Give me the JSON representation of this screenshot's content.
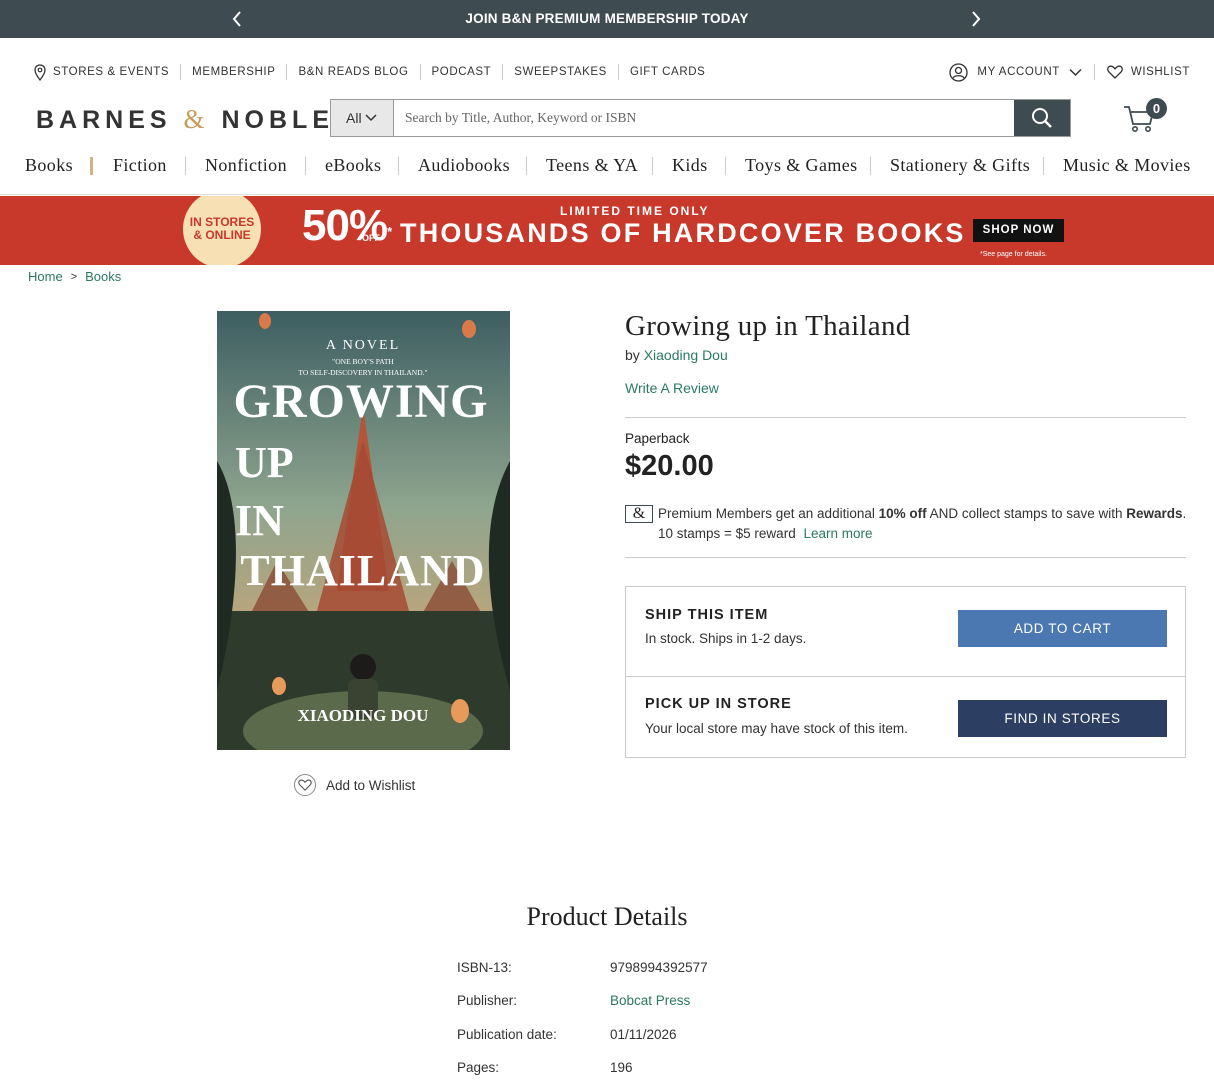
{
  "promo": {
    "message": "JOIN B&N PREMIUM MEMBERSHIP TODAY"
  },
  "utility_nav": {
    "links": [
      "STORES & EVENTS",
      "MEMBERSHIP",
      "B&N READS BLOG",
      "PODCAST",
      "SWEEPSTAKES",
      "GIFT CARDS"
    ],
    "account": "MY ACCOUNT",
    "wishlist": "WISHLIST"
  },
  "logo": {
    "part1": "BARNES",
    "amp": "&",
    "part2": "NOBLE"
  },
  "search": {
    "category": "All",
    "placeholder": "Search by Title, Author, Keyword or ISBN"
  },
  "cart": {
    "count": "0"
  },
  "categories": [
    "Books",
    "Fiction",
    "Nonfiction",
    "eBooks",
    "Audiobooks",
    "Teens & YA",
    "Kids",
    "Toys & Games",
    "Stationery & Gifts",
    "Music & Movies"
  ],
  "banner": {
    "badge_line1": "IN STORES",
    "badge_line2": "& ONLINE",
    "percent": "50%",
    "percent_sup": "*",
    "percent_off": "OFF",
    "limited": "LIMITED TIME ONLY",
    "headline": "THOUSANDS OF HARDCOVER BOOKS",
    "cta": "SHOP NOW",
    "fine_print": "*See page for details."
  },
  "breadcrumb": [
    "Home",
    "Books"
  ],
  "cover": {
    "tag": "A NOVEL",
    "quote_line1": "\"ONE BOY'S PATH",
    "quote_line2": "TO SELF-DISCOVERY IN THAILAND.\"",
    "word1": "GROWING",
    "word2": "UP",
    "word3": "IN",
    "word4": "THAILAND",
    "author": "XIAODING DOU"
  },
  "add_to_wishlist": "Add to Wishlist",
  "product": {
    "title": "Growing up in Thailand",
    "by": "by",
    "author": "Xiaoding Dou",
    "write_review": "Write A Review",
    "format": "Paperback",
    "price": "$20.00"
  },
  "premium": {
    "badge": "&",
    "text_a": "Premium Members get an additional",
    "discount": "10% off",
    "text_b": "AND collect stamps to save with",
    "rewards": "Rewards",
    "period": ".",
    "stamps": "10 stamps = $5 reward",
    "learn_more": "Learn more"
  },
  "fulfillment": {
    "ship_heading": "SHIP THIS ITEM",
    "ship_status": "In stock. Ships in 1-2 days.",
    "add_to_cart": "ADD TO CART",
    "pickup_heading": "PICK UP IN STORE",
    "pickup_status": "Your local store may have stock of this item.",
    "find_in_stores": "FIND IN STORES"
  },
  "product_details": {
    "heading": "Product Details",
    "rows": [
      {
        "label": "ISBN-13:",
        "value": "9798994392577"
      },
      {
        "label": "Publisher:",
        "value": "Bobcat Press"
      },
      {
        "label": "Publication date:",
        "value": "01/11/2026"
      },
      {
        "label": "Pages:",
        "value": "196"
      }
    ]
  },
  "colors": {
    "promo_bar": "#3e4b50",
    "link_green": "#2a7a5f",
    "banner_red": "#c8392c",
    "add_to_cart_blue": "#4b78b1",
    "find_in_stores_navy": "#2d3e63"
  },
  "icons": [
    "chevron-left-icon",
    "chevron-right-icon",
    "location-pin-icon",
    "user-circle-icon",
    "chevron-down-icon",
    "heart-icon",
    "search-icon",
    "cart-icon"
  ]
}
